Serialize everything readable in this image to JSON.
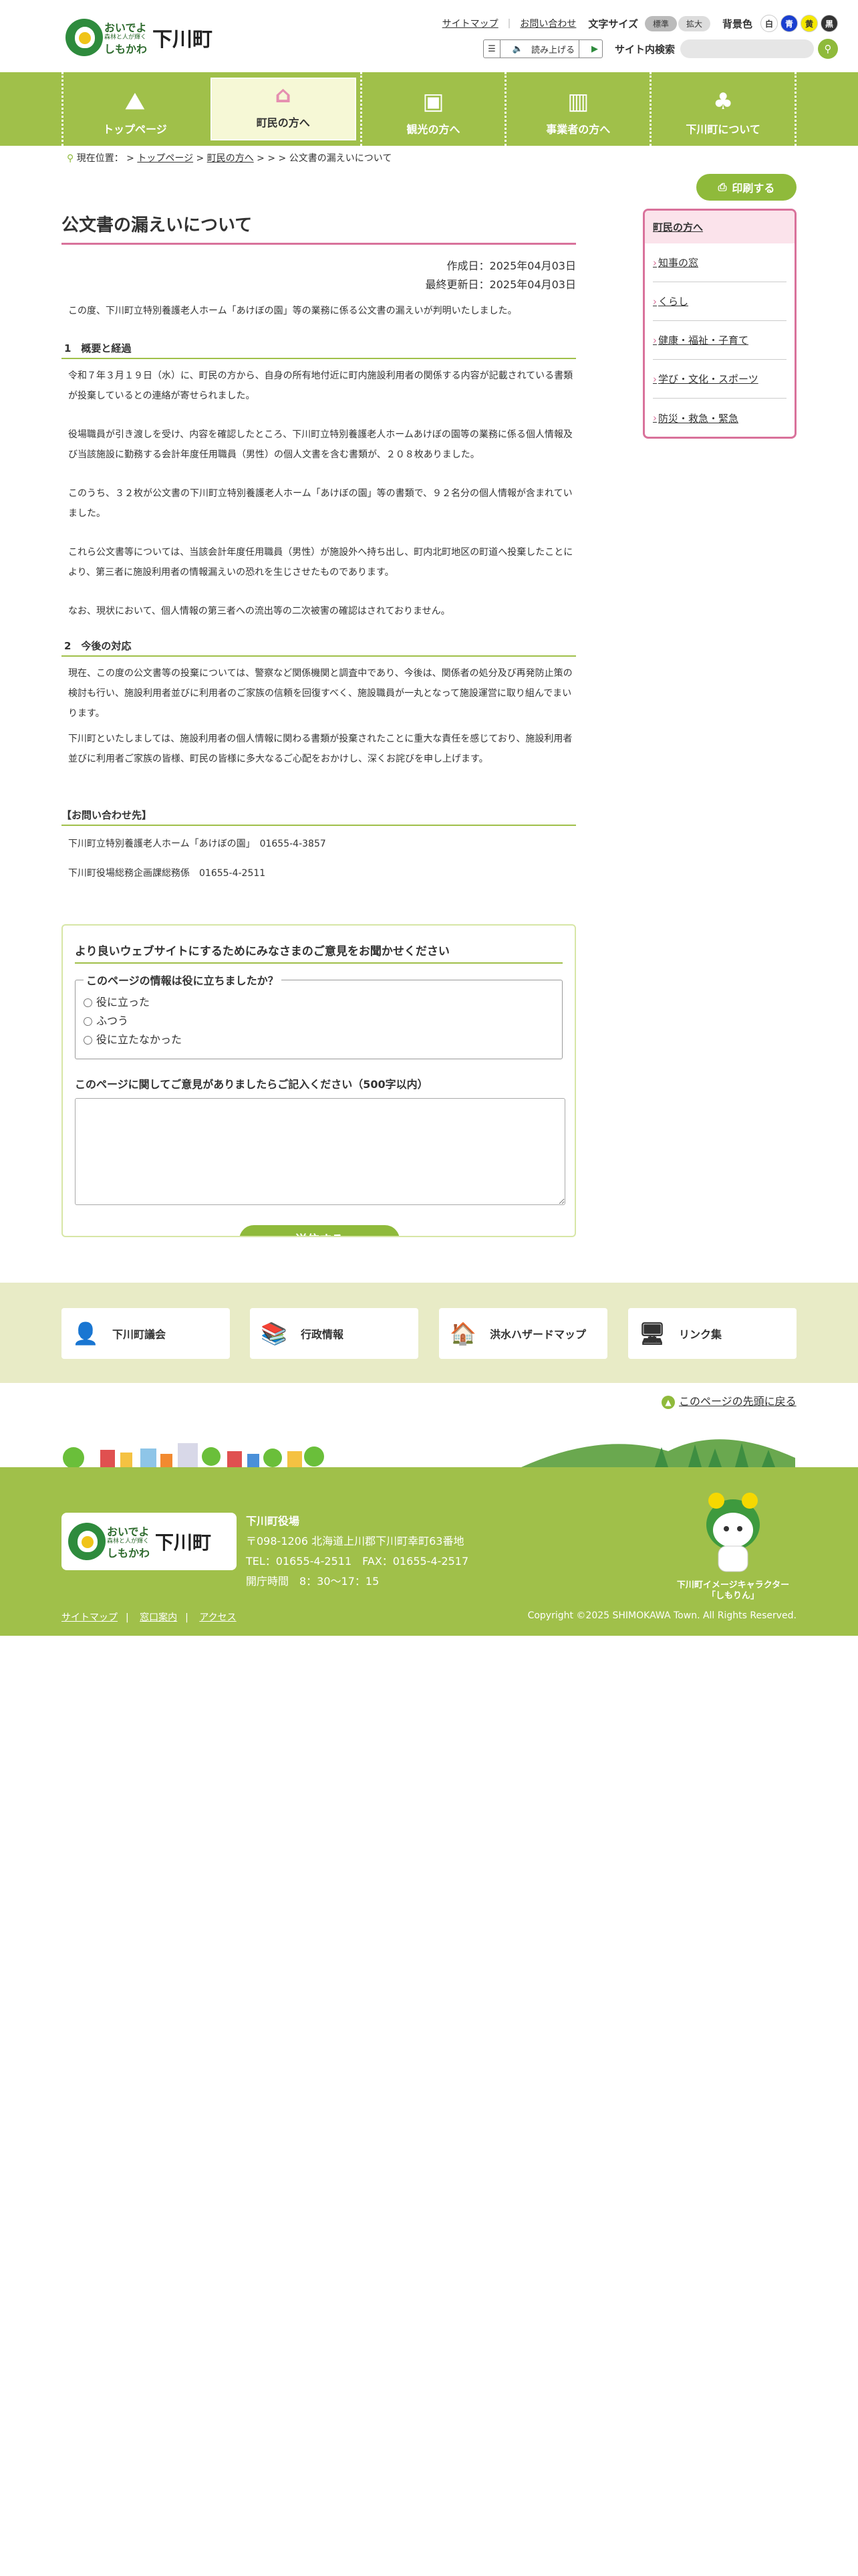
{
  "header": {
    "logo_line1": "おいでよ",
    "logo_line2": "森林と人が輝く",
    "logo_line3": "しもかわ",
    "site_name": "下川町",
    "sitemap": "サイトマップ",
    "contact": "お問い合わせ",
    "font_size_label": "文字サイズ",
    "font_standard": "標準",
    "font_large": "拡大",
    "bg_label": "背景色",
    "bg_options": [
      "白",
      "青",
      "黄",
      "黒"
    ],
    "read_aloud": "読み上げる",
    "search_label": "サイト内検索"
  },
  "nav": {
    "items": [
      {
        "label": "トップページ",
        "icon": "mountain-icon"
      },
      {
        "label": "町民の方へ",
        "icon": "house-icon"
      },
      {
        "label": "観光の方へ",
        "icon": "luggage-icon"
      },
      {
        "label": "事業者の方へ",
        "icon": "building-icon"
      },
      {
        "label": "下川町について",
        "icon": "tree-icon"
      }
    ],
    "active_index": 1
  },
  "breadcrumb": {
    "label": "現在位置：",
    "items": [
      "トップページ",
      "町民の方へ"
    ],
    "current": "公文書の漏えいについて"
  },
  "print_label": "印刷する",
  "article": {
    "title": "公文書の漏えいについて",
    "created": "作成日：2025年04月03日",
    "updated": "最終更新日：2025年04月03日",
    "intro": "この度、下川町立特別養護老人ホーム「あけぼの園」等の業務に係る公文書の漏えいが判明いたしました。",
    "h1": "1　概要と経過",
    "p1": "令和７年３月１９日（水）に、町民の方から、自身の所有地付近に町内施設利用者の関係する内容が記載されている書類が投棄しているとの連絡が寄せられました。",
    "p2": "役場職員が引き渡しを受け、内容を確認したところ、下川町立特別養護老人ホームあけぼの園等の業務に係る個人情報及び当該施設に勤務する会計年度任用職員（男性）の個人文書を含む書類が、２０８枚ありました。",
    "p3": "このうち、３２枚が公文書の下川町立特別養護老人ホーム「あけぼの園」等の書類で、９２名分の個人情報が含まれていました。",
    "p4": "これら公文書等については、当該会計年度任用職員（男性）が施設外へ持ち出し、町内北町地区の町道へ投棄したことにより、第三者に施設利用者の情報漏えいの恐れを生じさせたものであります。",
    "p5": "なお、現状において、個人情報の第三者への流出等の二次被害の確認はされておりません。",
    "h2": "2　今後の対応",
    "p6": "現在、この度の公文書等の投棄については、警察など関係機関と調査中であり、今後は、関係者の処分及び再発防止策の検討も行い、施設利用者並びに利用者のご家族の信頼を回復すべく、施設職員が一丸となって施設運営に取り組んでまいります。",
    "p7": "下川町といたしましては、施設利用者の個人情報に関わる書類が投棄されたことに重大な責任を感じており、施設利用者並びに利用者ご家族の皆様、町民の皆様に多大なるご心配をおかけし、深くお詫びを申し上げます。",
    "contact_heading": "【お問い合わせ先】",
    "contact1": "下川町立特別養護老人ホーム「あけぼの園」　01655-4-3857",
    "contact2": "下川町役場総務企画課総務係　01655-4-2511"
  },
  "survey": {
    "title": "より良いウェブサイトにするためにみなさまのご意見をお聞かせください",
    "question": "このページの情報は役に立ちましたか？",
    "options": [
      "役に立った",
      "ふつう",
      "役に立たなかった"
    ],
    "comment_label": "このページに関してご意見がありましたらご記入ください（500字以内）",
    "submit": "送信する"
  },
  "sidebar": {
    "heading": "町民の方へ",
    "items": [
      "知事の窓",
      "くらし",
      "健康・福祉・子育て",
      "学び・文化・スポーツ",
      "防災・救急・緊急"
    ]
  },
  "banners": [
    {
      "label": "下川町議会",
      "icon": "council-icon"
    },
    {
      "label": "行政情報",
      "icon": "books-icon"
    },
    {
      "label": "洪水ハザードマップ",
      "icon": "flood-icon"
    },
    {
      "label": "リンク集",
      "icon": "monitor-icon"
    }
  ],
  "back_to_top": "このページの先頭に戻る",
  "footer": {
    "office": "下川町役場",
    "address": "〒098-1206 北海道上川郡下川町幸町63番地",
    "tel": "TEL：01655-4-2511　FAX：01655-4-2517",
    "hours": "開庁時間　8：30〜17：15",
    "mascot": "下川町イメージキャラクター",
    "mascot_name": "「しもりん」",
    "links": [
      "サイトマップ",
      "窓口案内",
      "アクセス"
    ],
    "copyright": "Copyright ©2025 SHIMOKAWA Town. All Rights Reserved."
  },
  "colors": {
    "accent": "#a0c04a",
    "pink": "#d9729b"
  }
}
